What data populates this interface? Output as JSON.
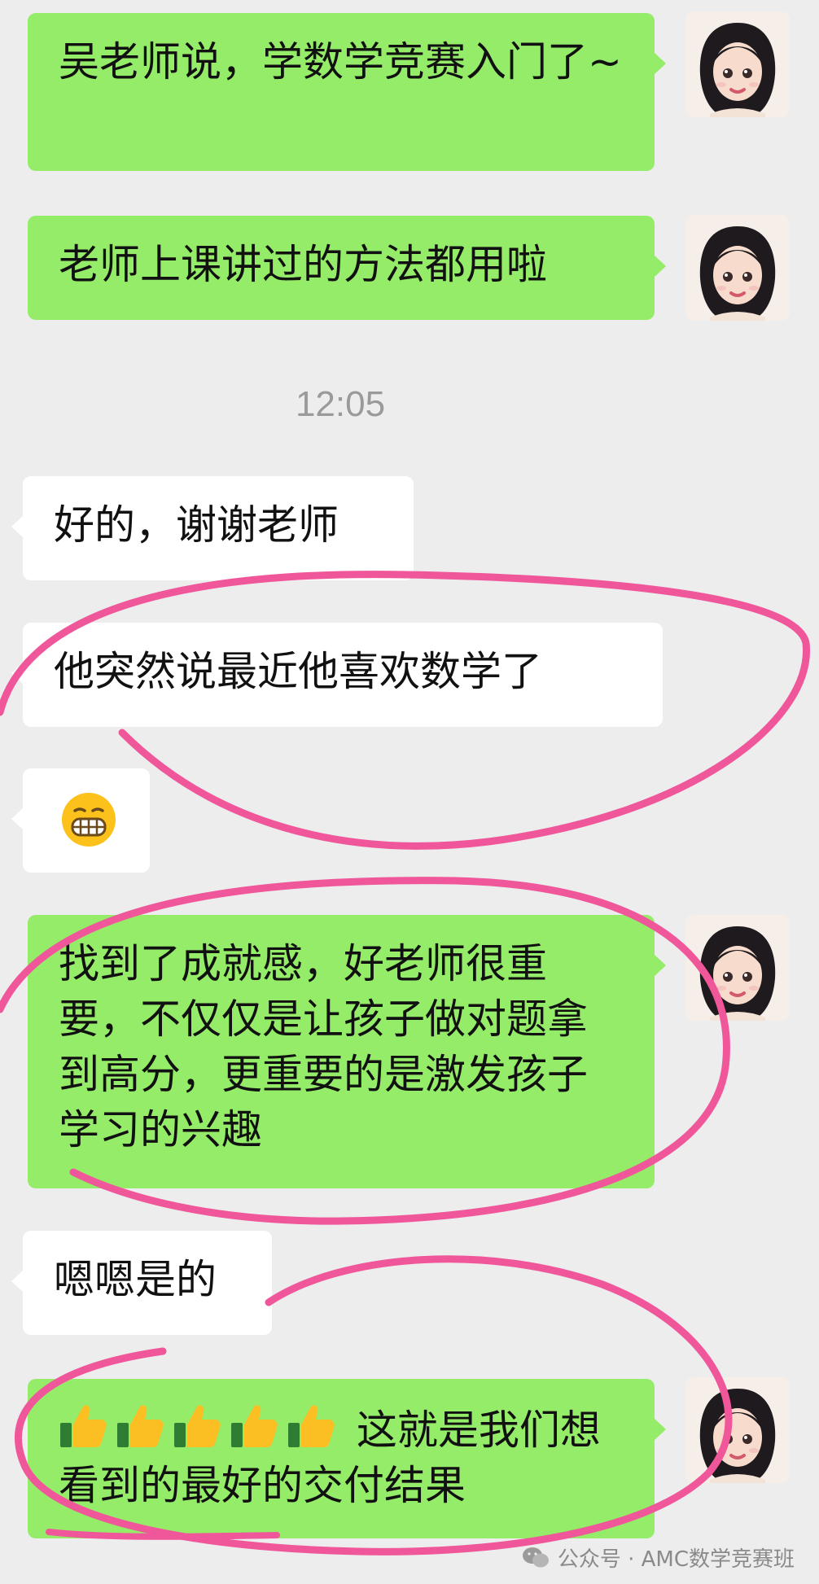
{
  "messages": [
    {
      "side": "out",
      "text": "吴老师说，学数学竞赛入门了~"
    },
    {
      "side": "out",
      "text": "老师上课讲过的方法都用啦"
    },
    {
      "side": "in",
      "text": "好的，谢谢老师"
    },
    {
      "side": "in",
      "text": "他突然说最近他喜欢数学了"
    },
    {
      "side": "in",
      "emoji": "grinning-face-emoji"
    },
    {
      "side": "out",
      "text": "找到了成就感，好老师很重要，不仅仅是让孩子做对题拿到高分，更重要的是激发孩子学习的兴趣"
    },
    {
      "side": "in",
      "text": "嗯嗯是的"
    },
    {
      "side": "out",
      "emoji_prefix": "thumbs-up-emoji x5",
      "text": "这就是我们想看到的最好的交付结果"
    }
  ],
  "timestamp": "12:05",
  "watermark": "公众号 · AMC数学竞赛班",
  "colors": {
    "background": "#ededed",
    "outgoing_bubble": "#95ec69",
    "incoming_bubble": "#ffffff",
    "annotation_ink": "#f0579a",
    "timestamp_text": "#9a9a9a"
  }
}
